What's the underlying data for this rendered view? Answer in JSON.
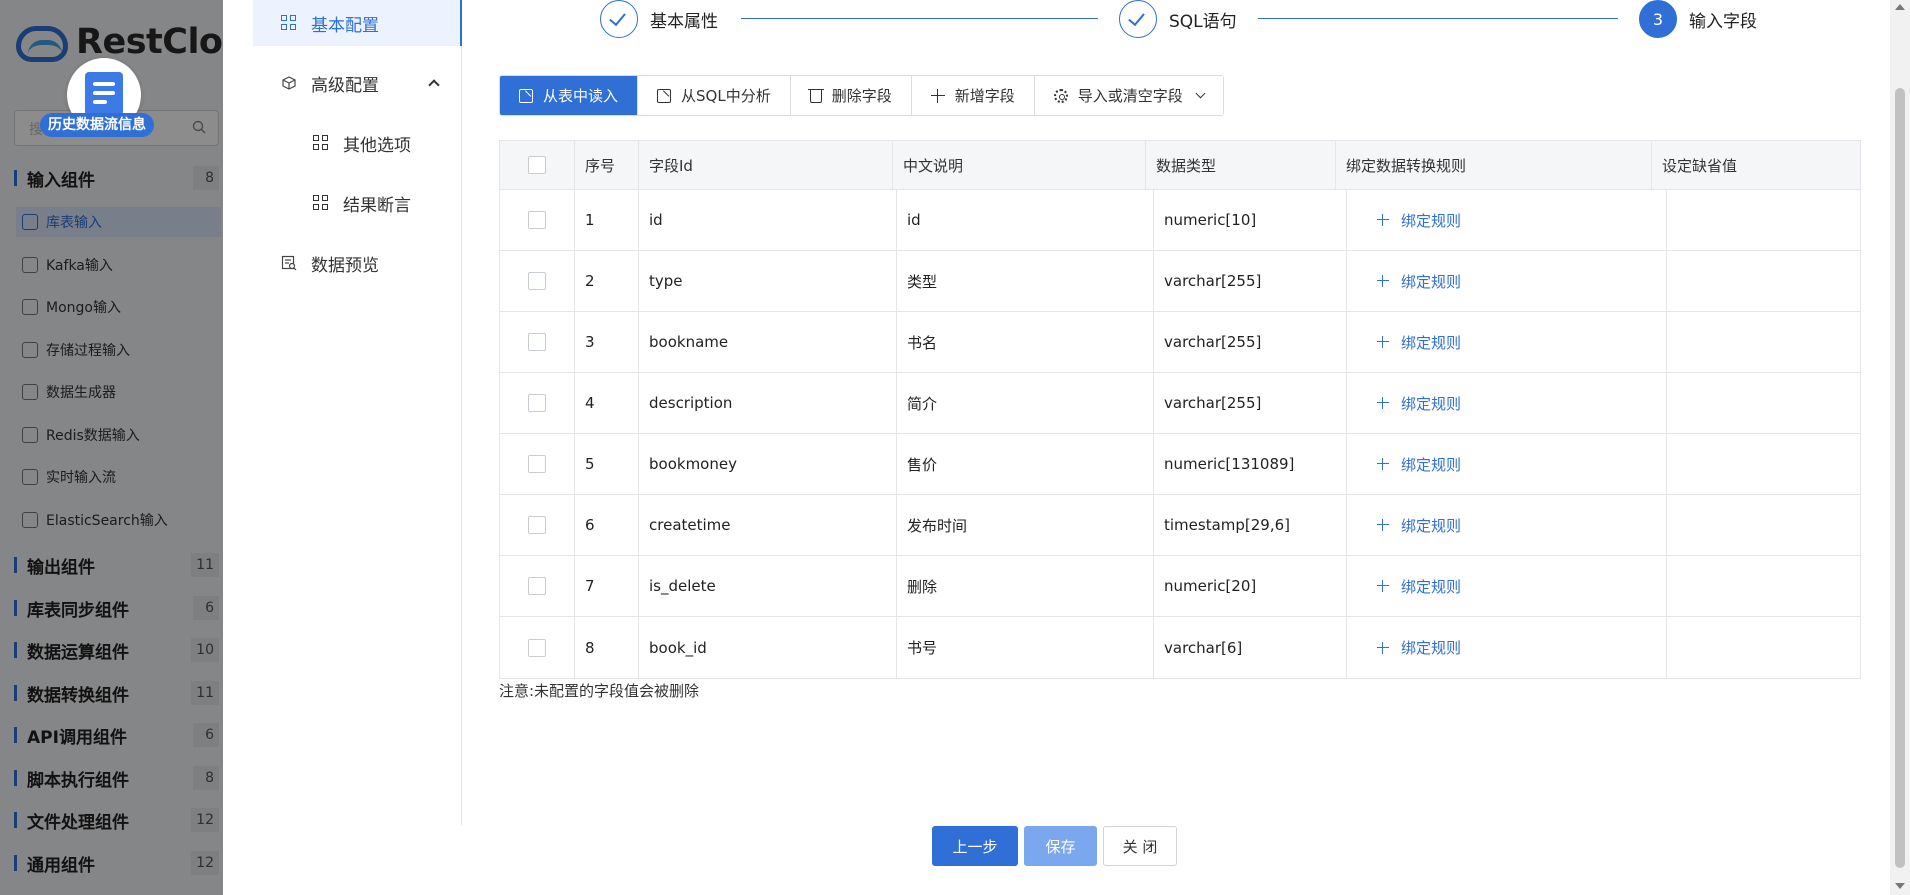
{
  "background": {
    "logo_text": "RestClo",
    "search_placeholder": "搜",
    "flow_badge": "历史数据流信息",
    "groups": [
      {
        "label": "输入组件",
        "count": "8"
      },
      {
        "label": "输出组件",
        "count": "11"
      },
      {
        "label": "库表同步组件",
        "count": "6"
      },
      {
        "label": "数据运算组件",
        "count": "10"
      },
      {
        "label": "数据转换组件",
        "count": "11"
      },
      {
        "label": "API调用组件",
        "count": "6"
      },
      {
        "label": "脚本执行组件",
        "count": "8"
      },
      {
        "label": "文件处理组件",
        "count": "12"
      },
      {
        "label": "通用组件",
        "count": "12"
      }
    ],
    "items": [
      {
        "label": "库表输入",
        "icon": "table-input-icon"
      },
      {
        "label": "Kafka输入",
        "icon": "kafka-icon"
      },
      {
        "label": "Mongo输入",
        "icon": "mongo-icon"
      },
      {
        "label": "存储过程输入",
        "icon": "procedure-icon"
      },
      {
        "label": "数据生成器",
        "icon": "generator-icon"
      },
      {
        "label": "Redis数据输入",
        "icon": "redis-icon"
      },
      {
        "label": "实时输入流",
        "icon": "stream-icon"
      },
      {
        "label": "ElasticSearch输入",
        "icon": "elasticsearch-icon"
      }
    ],
    "colors": {
      "accent": "#2f6fd6"
    }
  },
  "nav": {
    "items": [
      {
        "label": "基本配置",
        "icon": "grid-icon"
      },
      {
        "label": "高级配置",
        "icon": "cube-icon"
      },
      {
        "label": "其他选项",
        "icon": "grid-icon"
      },
      {
        "label": "结果断言",
        "icon": "grid-icon"
      },
      {
        "label": "数据预览",
        "icon": "preview-icon"
      }
    ]
  },
  "steps": [
    {
      "label": "基本属性",
      "state": "done"
    },
    {
      "label": "SQL语句",
      "state": "done"
    },
    {
      "label": "输入字段",
      "state": "current",
      "number": "3"
    }
  ],
  "toolbar": {
    "read_from_table": "从表中读入",
    "analyze_sql": "从SQL中分析",
    "delete_field": "删除字段",
    "add_field": "新增字段",
    "import_clear": "导入或清空字段"
  },
  "table": {
    "headers": {
      "no": "序号",
      "field_id": "字段Id",
      "cn_desc": "中文说明",
      "data_type": "数据类型",
      "rule": "绑定数据转换规则",
      "default": "设定缺省值"
    },
    "rule_link": "绑定规则",
    "rows": [
      {
        "no": "1",
        "field_id": "id",
        "cn_desc": "id",
        "data_type": "numeric[10]",
        "default": ""
      },
      {
        "no": "2",
        "field_id": "type",
        "cn_desc": "类型",
        "data_type": "varchar[255]",
        "default": ""
      },
      {
        "no": "3",
        "field_id": "bookname",
        "cn_desc": "书名",
        "data_type": "varchar[255]",
        "default": ""
      },
      {
        "no": "4",
        "field_id": "description",
        "cn_desc": "简介",
        "data_type": "varchar[255]",
        "default": ""
      },
      {
        "no": "5",
        "field_id": "bookmoney",
        "cn_desc": "售价",
        "data_type": "numeric[131089]",
        "default": ""
      },
      {
        "no": "6",
        "field_id": "createtime",
        "cn_desc": "发布时间",
        "data_type": "timestamp[29,6]",
        "default": ""
      },
      {
        "no": "7",
        "field_id": "is_delete",
        "cn_desc": "删除",
        "data_type": "numeric[20]",
        "default": ""
      },
      {
        "no": "8",
        "field_id": "book_id",
        "cn_desc": "书号",
        "data_type": "varchar[6]",
        "default": ""
      }
    ]
  },
  "note": "注意:未配置的字段值会被删除",
  "footer": {
    "prev": "上一步",
    "save": "保存",
    "close": "关 闭"
  }
}
